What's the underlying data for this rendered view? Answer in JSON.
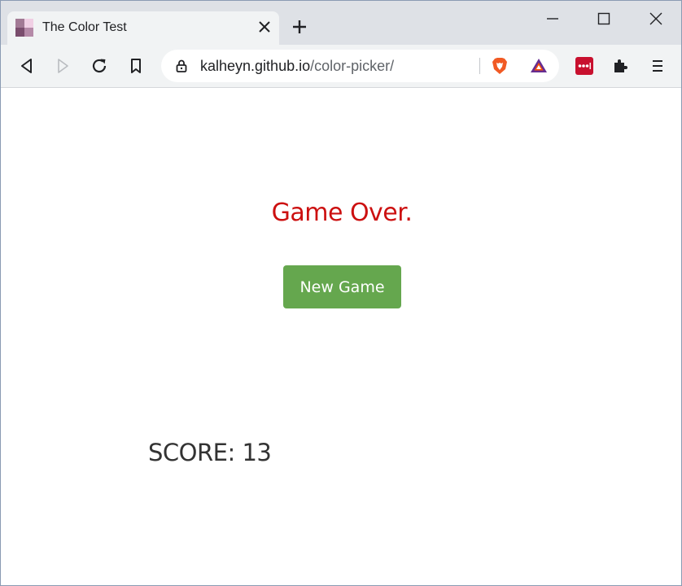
{
  "browser": {
    "tab_title": "The Color Test",
    "url_host": "kalheyn.github.io",
    "url_path": "/color-picker/"
  },
  "page": {
    "status_text": "Game Over.",
    "new_game_label": "New Game",
    "score_text": "SCORE: 13"
  },
  "icons": {
    "favicon": "color-grid-favicon",
    "tab_close": "close-icon",
    "new_tab": "plus-icon",
    "minimize": "minimize-icon",
    "maximize": "maximize-icon",
    "close_window": "close-icon",
    "back": "back-icon",
    "forward": "forward-icon",
    "reload": "reload-icon",
    "bookmark": "bookmark-icon",
    "lock": "lock-icon",
    "brave": "brave-lion-icon",
    "bat": "bat-triangle-icon",
    "lastpass": "lastpass-icon",
    "extensions": "puzzle-icon",
    "menu": "menu-icon"
  },
  "colors": {
    "status_text": "#cc1010",
    "new_game_button": "#65a74e",
    "score_text": "#333333",
    "tabstrip": "#dee1e6",
    "toolbar": "#f1f3f4"
  }
}
